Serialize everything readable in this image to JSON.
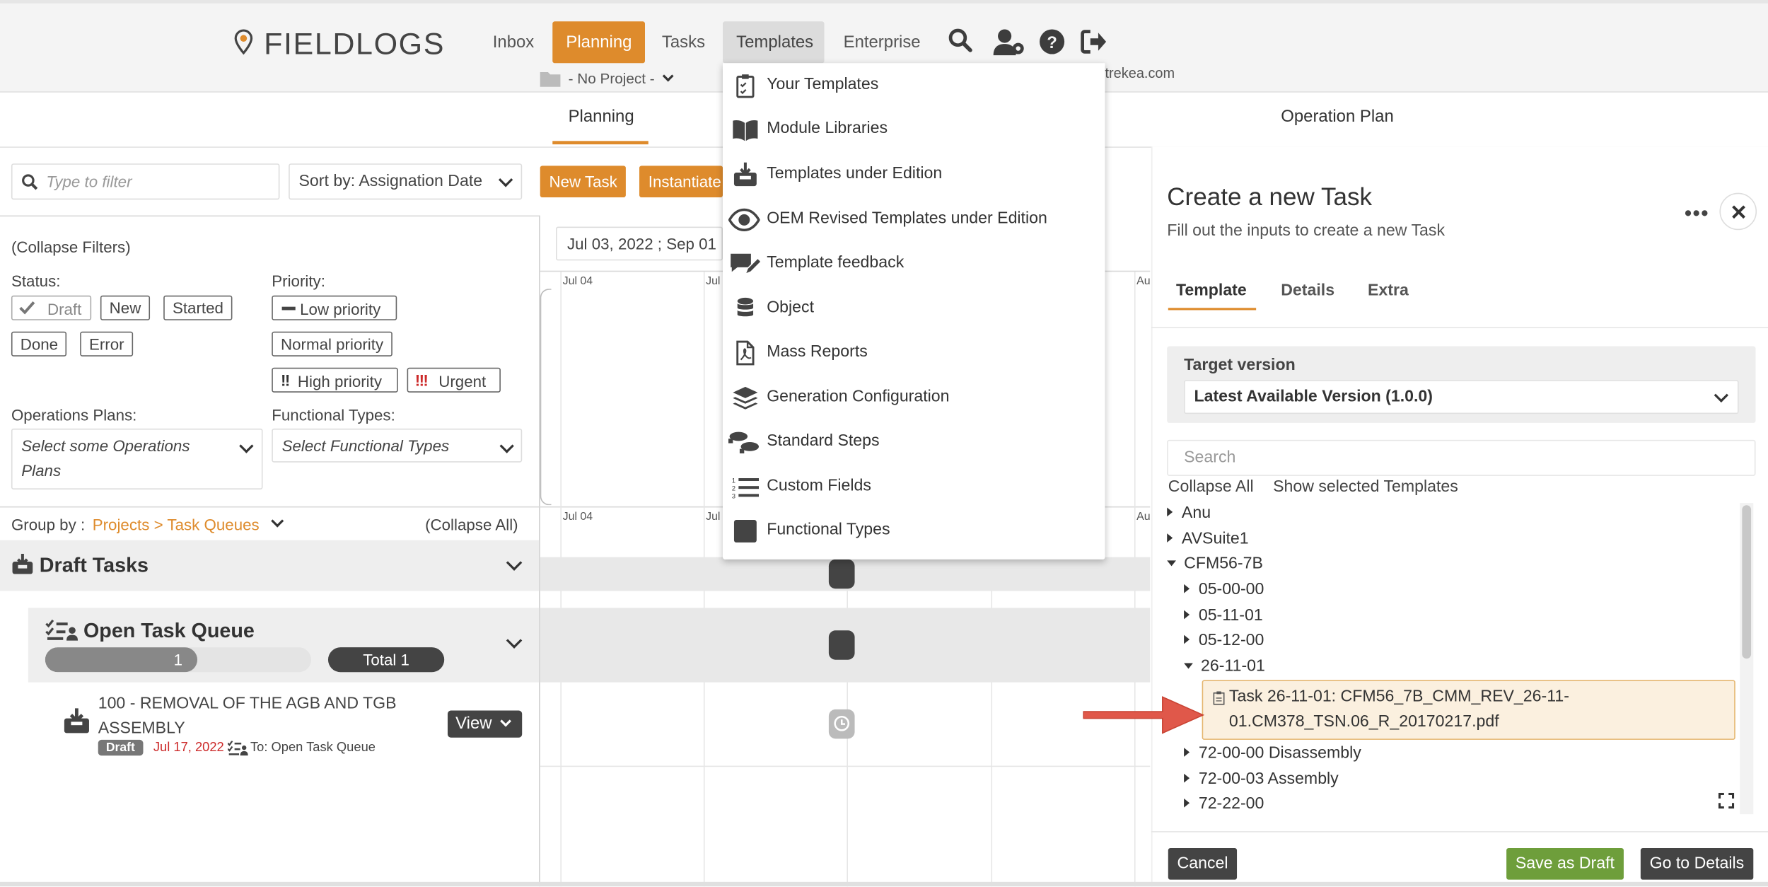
{
  "header": {
    "logo_text": "FIELDLOGS",
    "nav": [
      "Inbox",
      "Planning",
      "Tasks",
      "Templates",
      "Enterprise"
    ],
    "project_selector": "- No Project -",
    "user_domain": "trekea.com"
  },
  "tabs": {
    "planning": "Planning",
    "operation_plan": "Operation Plan"
  },
  "toolbar": {
    "filter_placeholder": "Type to filter",
    "sort_label": "Sort by: Assignation Date",
    "new_task": "New Task",
    "instantiate": "Instantiate",
    "date_range": "Jul 03, 2022 ; Sep 01"
  },
  "filters": {
    "collapse": "(Collapse Filters)",
    "status_label": "Status:",
    "status": [
      "Draft",
      "New",
      "Started",
      "Done",
      "Error"
    ],
    "priority_label": "Priority:",
    "priority": [
      "Low priority",
      "Normal priority",
      "High priority",
      "Urgent"
    ],
    "ops_label": "Operations Plans:",
    "ops_placeholder": "Select some Operations Plans",
    "ft_label": "Functional Types:",
    "ft_placeholder": "Select Functional Types"
  },
  "group": {
    "label": "Group by :",
    "value": "Projects > Task Queues",
    "collapse_all": "(Collapse All)"
  },
  "timeline": {
    "labels": [
      "Jul 04",
      "Jul",
      "Au"
    ]
  },
  "draft_tasks": {
    "title": "Draft Tasks"
  },
  "queue": {
    "title": "Open Task Queue",
    "count": "1",
    "total": "Total 1",
    "count_fraction": 0.57
  },
  "task": {
    "title": "100 - REMOVAL OF THE AGB AND TGB ASSEMBLY",
    "badge": "Draft",
    "date": "Jul 17, 2022",
    "queue": "To: Open Task Queue",
    "view": "View"
  },
  "templates_menu": [
    {
      "label": "Your Templates",
      "icon": "clipboard-check-icon"
    },
    {
      "label": "Module Libraries",
      "icon": "open-book-icon"
    },
    {
      "label": "Templates under Edition",
      "icon": "inbox-download-icon"
    },
    {
      "label": "OEM Revised Templates under Edition",
      "icon": "eye-icon"
    },
    {
      "label": "Template feedback",
      "icon": "comment-pen-icon"
    },
    {
      "label": "Object",
      "icon": "database-icon"
    },
    {
      "label": "Mass Reports",
      "icon": "pdf-file-icon"
    },
    {
      "label": "Generation Configuration",
      "icon": "layers-icon"
    },
    {
      "label": "Standard Steps",
      "icon": "footprints-icon"
    },
    {
      "label": "Custom Fields",
      "icon": "list-icon"
    },
    {
      "label": "Functional Types",
      "icon": "square-icon"
    }
  ],
  "panel": {
    "title": "Create a new Task",
    "subtitle": "Fill out the inputs to create a new Task",
    "tabs": [
      "Template",
      "Details",
      "Extra"
    ],
    "target_label": "Target version",
    "target_value": "Latest Available Version (1.0.0)",
    "search_placeholder": "Search",
    "collapse_all": "Collapse All",
    "show_selected": "Show selected Templates",
    "tree": {
      "anu": "Anu",
      "avsuite": "AVSuite1",
      "cfm": "CFM56-7B",
      "c1": "05-00-00",
      "c2": "05-11-01",
      "c3": "05-12-00",
      "c4": "26-11-01",
      "selected_line1": "Task 26-11-01: CFM56_7B_CMM_REV_26-11-",
      "selected_line2": "01.CM378_TSN.06_R_20170217.pdf",
      "c5": "72-00-00 Disassembly",
      "c6": "72-00-03 Assembly",
      "c7": "72-22-00"
    },
    "cancel": "Cancel",
    "save_draft": "Save as Draft",
    "go_details": "Go to Details"
  },
  "colors": {
    "accent": "#de8b2c",
    "green": "#6e9e3b",
    "dark": "#444444",
    "selected_bg": "#fbf0df",
    "arrow": "#e0584a",
    "urgent": "#cc2a2a"
  }
}
